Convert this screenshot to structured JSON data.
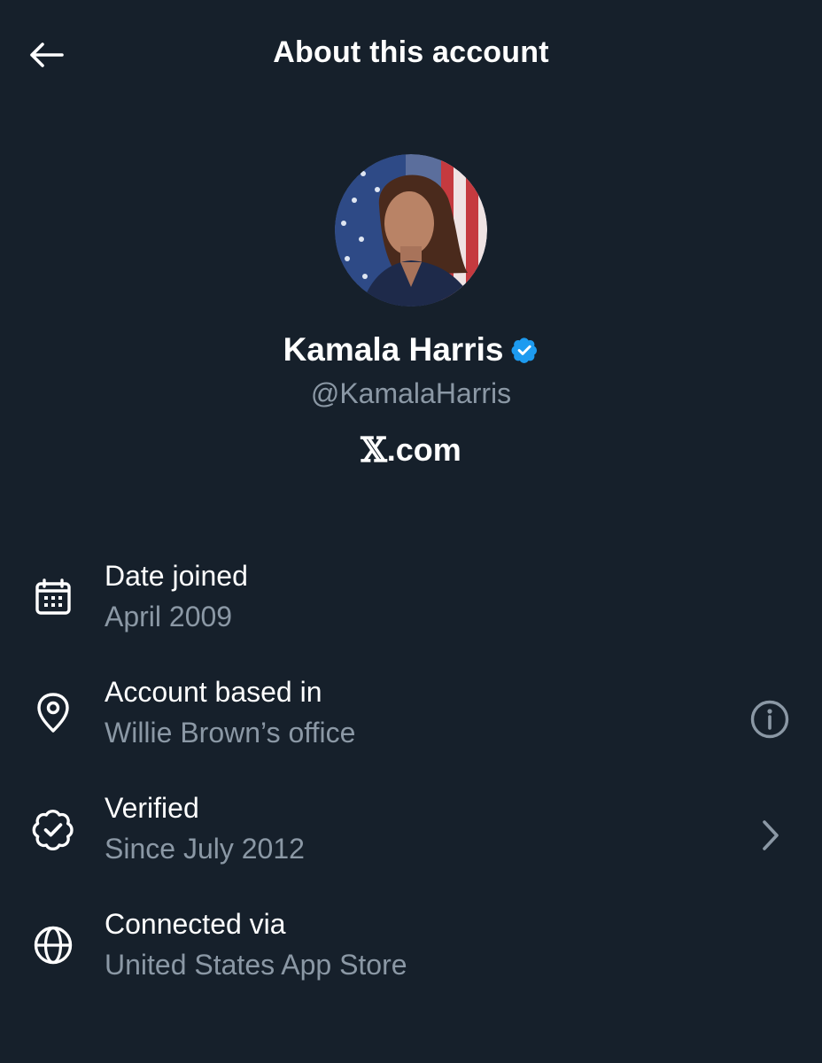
{
  "header": {
    "title": "About this account",
    "back_icon": "arrow-left-icon"
  },
  "profile": {
    "name": "Kamala Harris",
    "verified_icon": "verified-badge-icon",
    "verified_color": "#1d9bf0",
    "handle": "@KamalaHarris",
    "site_logo": "𝕏",
    "site_suffix": ".com"
  },
  "rows": [
    {
      "icon": "calendar-icon",
      "label": "Date joined",
      "value": "April 2009"
    },
    {
      "icon": "location-pin-icon",
      "label": "Account based in",
      "value": "Willie Brown’s office",
      "action_icon": "info-icon"
    },
    {
      "icon": "verified-outline-icon",
      "label": "Verified",
      "value": "Since July 2012",
      "action_icon": "chevron-right-icon"
    },
    {
      "icon": "globe-icon",
      "label": "Connected via",
      "value": "United States App Store"
    }
  ],
  "colors": {
    "background": "#16202b",
    "primary_text": "#ffffff",
    "secondary_text": "#8b98a5"
  }
}
